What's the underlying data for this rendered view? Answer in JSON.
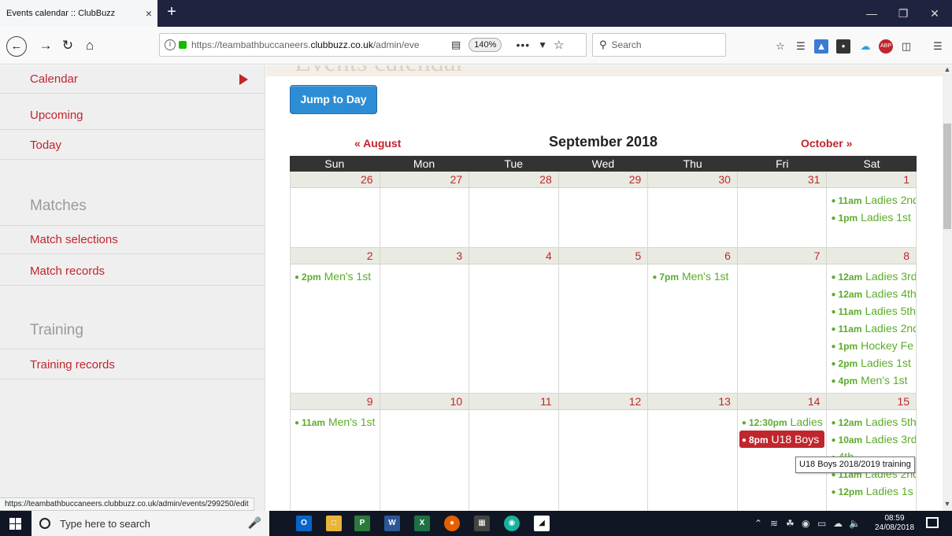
{
  "browser": {
    "tab_title": "Events calendar :: ClubBuzz",
    "tab_close": "×",
    "new_tab": "+",
    "url_prefix": "https://teambathbuccaneers.",
    "url_domain": "clubbuzz.co.uk",
    "url_path": "/admin/eve",
    "zoom": "140%",
    "search_placeholder": "Search",
    "status_url": "https://teambathbuccaneers.clubbuzz.co.uk/admin/events/299250/edit"
  },
  "page": {
    "header_ghost": "Events calendar"
  },
  "sidebar": {
    "items_top": [
      {
        "label": "Calendar",
        "active": true
      },
      {
        "label": "Upcoming"
      },
      {
        "label": "Today"
      }
    ],
    "matches_heading": "Matches",
    "matches_items": [
      {
        "label": "Match selections"
      },
      {
        "label": "Match records"
      }
    ],
    "training_heading": "Training",
    "training_items": [
      {
        "label": "Training records"
      }
    ]
  },
  "calendar": {
    "jump_label": "Jump to Day",
    "prev_label": "« August",
    "month_title": "September 2018",
    "next_label": "October »",
    "weekdays": [
      "Sun",
      "Mon",
      "Tue",
      "Wed",
      "Thu",
      "Fri",
      "Sat"
    ],
    "weeks": [
      {
        "days": [
          "26",
          "27",
          "28",
          "29",
          "30",
          "31",
          "1"
        ],
        "events": [
          [],
          [],
          [],
          [],
          [],
          [],
          [
            {
              "time": "11am",
              "title": "Ladies 2nd"
            },
            {
              "time": "1pm",
              "title": "Ladies 1st"
            }
          ]
        ]
      },
      {
        "days": [
          "2",
          "3",
          "4",
          "5",
          "6",
          "7",
          "8"
        ],
        "events": [
          [
            {
              "time": "2pm",
              "title": "Men's 1st"
            }
          ],
          [],
          [],
          [],
          [
            {
              "time": "7pm",
              "title": "Men's 1st"
            }
          ],
          [],
          [
            {
              "time": "12am",
              "title": "Ladies 3rd"
            },
            {
              "time": "12am",
              "title": "Ladies 4th"
            },
            {
              "time": "11am",
              "title": "Ladies 5th"
            },
            {
              "time": "11am",
              "title": "Ladies 2nd"
            },
            {
              "time": "1pm",
              "title": "Hockey Fe"
            },
            {
              "time": "2pm",
              "title": "Ladies 1st"
            },
            {
              "time": "4pm",
              "title": "Men's 1st"
            }
          ]
        ]
      },
      {
        "days": [
          "9",
          "10",
          "11",
          "12",
          "13",
          "14",
          "15"
        ],
        "events": [
          [
            {
              "time": "11am",
              "title": "Men's 1st"
            }
          ],
          [],
          [],
          [],
          [],
          [
            {
              "time": "12:30pm",
              "title": "Ladies"
            },
            {
              "time": "8pm",
              "title": "U18 Boys",
              "highlight": true
            }
          ],
          [
            {
              "time": "12am",
              "title": "Ladies 5th"
            },
            {
              "time": "10am",
              "title": "Ladies 3rd"
            },
            {
              "time": "",
              "title": "4th"
            },
            {
              "time": "11am",
              "title": "Ladies 2nd"
            },
            {
              "time": "12pm",
              "title": "Ladies 1s"
            }
          ]
        ]
      }
    ],
    "tooltip": "U18 Boys 2018/2019 training"
  },
  "taskbar": {
    "search_placeholder": "Type here to search",
    "time": "08:59",
    "date": "24/08/2018"
  }
}
